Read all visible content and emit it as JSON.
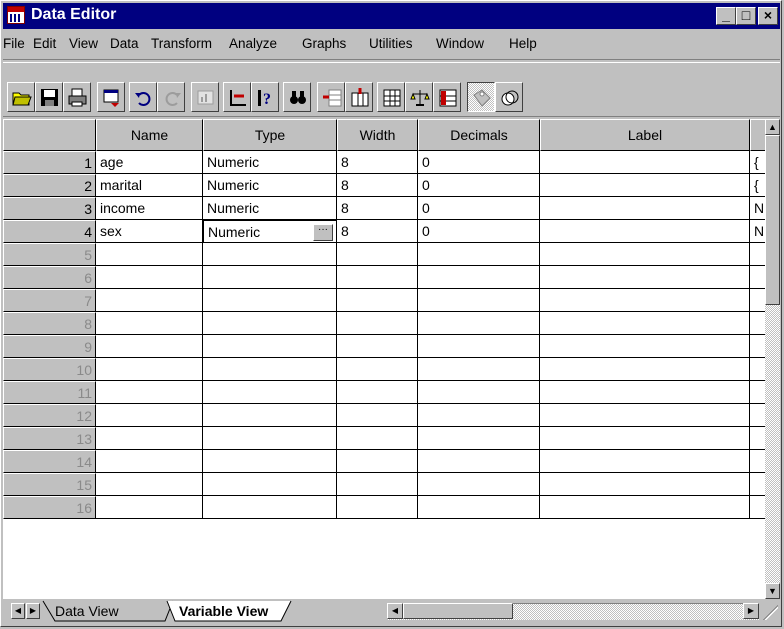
{
  "window": {
    "title": "Data Editor",
    "minimize": "_",
    "maximize": "□",
    "close": "×"
  },
  "menu": [
    "File",
    "Edit",
    "View",
    "Data",
    "Transform",
    "Analyze",
    "Graphs",
    "Utilities",
    "Window",
    "Help"
  ],
  "toolbar": [
    {
      "name": "open-icon"
    },
    {
      "name": "save-icon"
    },
    {
      "name": "print-icon"
    },
    {
      "name": "dialog-recall-icon"
    },
    {
      "name": "undo-icon"
    },
    {
      "name": "redo-icon"
    },
    {
      "name": "goto-chart-icon"
    },
    {
      "name": "goto-case-icon"
    },
    {
      "name": "variables-icon"
    },
    {
      "name": "find-icon"
    },
    {
      "name": "insert-case-icon"
    },
    {
      "name": "insert-variable-icon"
    },
    {
      "name": "split-file-icon"
    },
    {
      "name": "weight-cases-icon"
    },
    {
      "name": "select-cases-icon"
    },
    {
      "name": "value-labels-icon"
    },
    {
      "name": "use-sets-icon"
    }
  ],
  "columns": [
    "Name",
    "Type",
    "Width",
    "Decimals",
    "Label"
  ],
  "rows": [
    {
      "num": "1",
      "name": "age",
      "type": "Numeric",
      "width": "8",
      "decimals": "0",
      "label": "",
      "values": "{"
    },
    {
      "num": "2",
      "name": "marital",
      "type": "Numeric",
      "width": "8",
      "decimals": "0",
      "label": "",
      "values": "{"
    },
    {
      "num": "3",
      "name": "income",
      "type": "Numeric",
      "width": "8",
      "decimals": "0",
      "label": "",
      "values": "N"
    },
    {
      "num": "4",
      "name": "sex",
      "type": "Numeric",
      "width": "8",
      "decimals": "0",
      "label": "",
      "values": "N"
    }
  ],
  "empty_rows": [
    "5",
    "6",
    "7",
    "8",
    "9",
    "10",
    "11",
    "12",
    "13",
    "14",
    "15",
    "16"
  ],
  "active_cell": {
    "row": "4",
    "column": "Type",
    "button": "···"
  },
  "tabs": {
    "data_view": "Data View",
    "variable_view": "Variable View",
    "active": "Variable View"
  },
  "colors": {
    "titlebar": "#000080",
    "face": "#c0c0c0"
  }
}
